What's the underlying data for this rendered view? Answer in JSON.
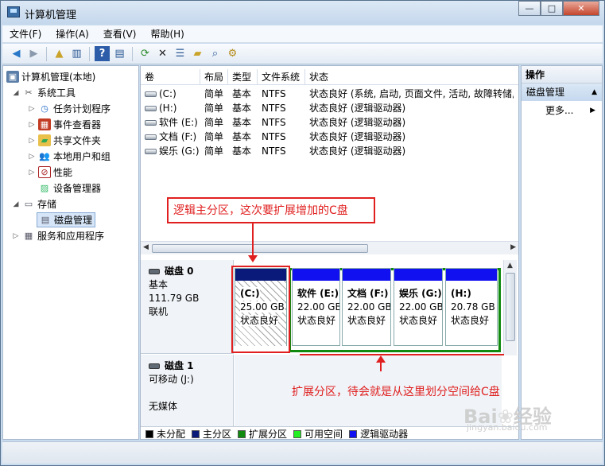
{
  "window": {
    "title": "计算机管理",
    "minimize": "—",
    "maximize": "□",
    "close": "✕"
  },
  "menu": [
    "文件(F)",
    "操作(A)",
    "查看(V)",
    "帮助(H)"
  ],
  "toolbar": [
    "back-arrow-icon",
    "forward-arrow-icon",
    "up-folder-icon",
    "show-tree-icon",
    "help-icon",
    "console-icon",
    "refresh-icon",
    "delete-icon",
    "properties-icon",
    "open-folder-icon",
    "search-icon",
    "settings-icon"
  ],
  "tree": {
    "root": "计算机管理(本地)",
    "system_tools": "系统工具",
    "task_scheduler": "任务计划程序",
    "event_viewer": "事件查看器",
    "shared_folders": "共享文件夹",
    "local_users": "本地用户和组",
    "performance": "性能",
    "device_manager": "设备管理器",
    "storage": "存储",
    "disk_management": "磁盘管理",
    "services_apps": "服务和应用程序"
  },
  "volumes": {
    "headers": [
      "卷",
      "布局",
      "类型",
      "文件系统",
      "状态"
    ],
    "rows": [
      [
        "(C:)",
        "简单",
        "基本",
        "NTFS",
        "状态良好 (系统, 启动, 页面文件, 活动, 故障转储, 主"
      ],
      [
        "(H:)",
        "简单",
        "基本",
        "NTFS",
        "状态良好 (逻辑驱动器)"
      ],
      [
        "软件 (E:)",
        "简单",
        "基本",
        "NTFS",
        "状态良好 (逻辑驱动器)"
      ],
      [
        "文档 (F:)",
        "简单",
        "基本",
        "NTFS",
        "状态良好 (逻辑驱动器)"
      ],
      [
        "娱乐 (G:)",
        "简单",
        "基本",
        "NTFS",
        "状态良好 (逻辑驱动器)"
      ]
    ]
  },
  "disks": [
    {
      "name": "磁盘 0",
      "type": "基本",
      "size": "111.79 GB",
      "state": "联机"
    },
    {
      "name": "磁盘 1",
      "type": "可移动 (J:)",
      "size": "",
      "state": "无媒体"
    }
  ],
  "partitions": [
    {
      "name": "(C:)",
      "size": "25.00 GB",
      "status": "状态良好"
    },
    {
      "name": "软件 (E:)",
      "size": "22.00 GB",
      "status": "状态良好"
    },
    {
      "name": "文档 (F:)",
      "size": "22.00 GB",
      "status": "状态良好"
    },
    {
      "name": "娱乐 (G:)",
      "size": "22.00 GB",
      "status": "状态良好"
    },
    {
      "name": "(H:)",
      "size": "20.78 GB",
      "status": "状态良好"
    }
  ],
  "legend": [
    {
      "label": "未分配",
      "color": "#000000"
    },
    {
      "label": "主分区",
      "color": "#0a1a7a"
    },
    {
      "label": "扩展分区",
      "color": "#0f8a0f"
    },
    {
      "label": "可用空间",
      "color": "#22ee22"
    },
    {
      "label": "逻辑驱动器",
      "color": "#1010f0"
    }
  ],
  "actions": {
    "header": "操作",
    "section": "磁盘管理",
    "more": "更多..."
  },
  "annotations": {
    "top": "逻辑主分区，这次要扩展增加的C盘",
    "bottom": "扩展分区，待会就是从这里划分空间给C盘"
  },
  "colors": {
    "primary_bar": "#0a1a7a",
    "logical_bar": "#1010f0",
    "extended_border": "#0f8a0f",
    "annotation": "#e02020"
  }
}
